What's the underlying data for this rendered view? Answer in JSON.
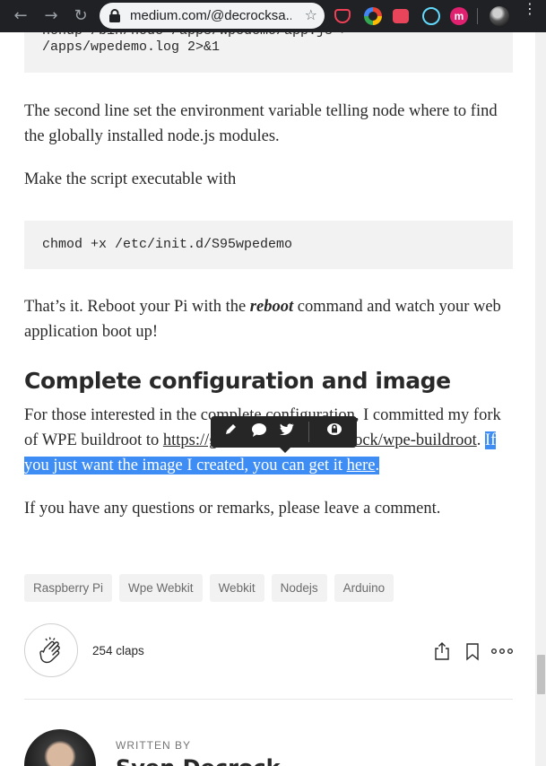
{
  "browser": {
    "url": "medium.com/@decrocksa...",
    "back_icon": "←",
    "forward_icon": "→",
    "reload_icon": "↻",
    "star_icon": "☆",
    "menu_icon": "⋮",
    "extension_m_label": "m"
  },
  "article": {
    "code1_lines": [
      "nohup /bin/node /apps/wpedemo/app.js >",
      "/apps/wpedemo.log 2>&1"
    ],
    "p1": "The second line set the environment variable telling node where to find the globally installed node.js modules.",
    "p2": "Make the script executable with",
    "code2": "chmod +x /etc/init.d/S95wpedemo",
    "p3_before": "That’s it. Reboot your Pi with the ",
    "p3_emph": "reboot",
    "p3_after": " command and watch your web application boot up!",
    "heading": "Complete configuration and image",
    "p4_part1": "For those interested in the complete configuration, I committed my fork of WPE buildroot to ",
    "p4_link": "https://github.com/SvenDecrock/wpe-buildroot",
    "p4_part2": ". ",
    "p4_highlight_text": "If you just want the image I created, you can get it ",
    "p4_highlight_link": "here",
    "p4_highlight_end": ".",
    "p5": "If you have any questions or remarks, please leave a comment."
  },
  "tags": [
    "Raspberry Pi",
    "Wpe Webkit",
    "Webkit",
    "Nodejs",
    "Arduino"
  ],
  "claps": {
    "count_label": "254 claps"
  },
  "author": {
    "written_by": "WRITTEN BY",
    "name": "Sven Decrock"
  },
  "colors": {
    "highlight": "#3d8df5",
    "toolbar": "#262626",
    "chrome": "#202124"
  }
}
